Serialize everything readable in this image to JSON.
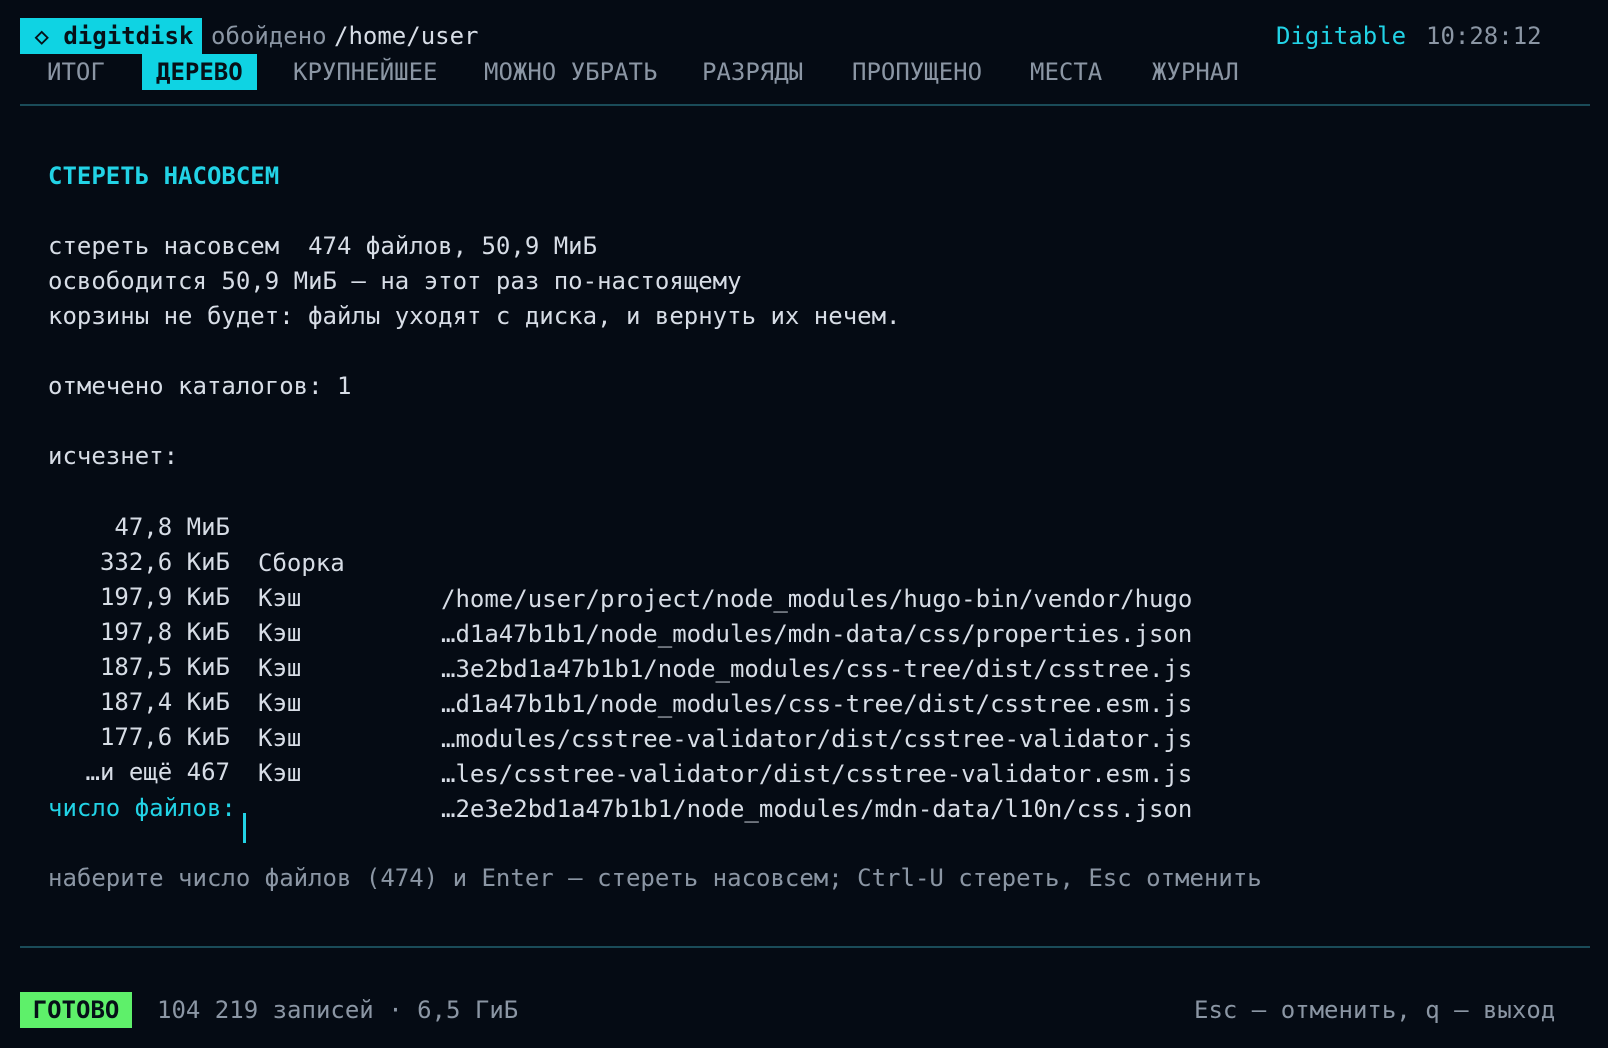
{
  "header": {
    "app_badge": " ◇ digitdisk",
    "scanned_label": "обойдено",
    "path": "/home/user",
    "theme": "Digitable",
    "clock": "10:28:12"
  },
  "tabs": [
    {
      "label": "ИТОГ",
      "active": false
    },
    {
      "label": "ДЕРЕВО",
      "active": true
    },
    {
      "label": "КРУПНЕЙШЕЕ",
      "active": false
    },
    {
      "label": "МОЖНО УБРАТЬ",
      "active": false
    },
    {
      "label": "РАЗРЯДЫ",
      "active": false
    },
    {
      "label": "ПРОПУЩЕНО",
      "active": false
    },
    {
      "label": "МЕСТА",
      "active": false
    },
    {
      "label": "ЖУРНАЛ",
      "active": false
    }
  ],
  "dialog": {
    "title": "СТЕРЕТЬ НАСОВСЕМ",
    "summary_line": "стереть насовсем  474 файлов, 50,9 МиБ",
    "free_line": "освободится 50,9 МиБ — на этот раз по-настоящему",
    "warning_line": "корзины не будет: файлы уходят с диска, и вернуть их нечем.",
    "dirs_line": "отмечено каталогов: 1",
    "vanish_label": "исчезнет:",
    "files": [
      {
        "size": "47,8 МиБ",
        "kind": "Сборка",
        "path": "/home/user/project/node_modules/hugo-bin/vendor/hugo"
      },
      {
        "size": "332,6 КиБ",
        "kind": "Кэш",
        "path": "…d1a47b1b1/node_modules/mdn-data/css/properties.json"
      },
      {
        "size": "197,9 КиБ",
        "kind": "Кэш",
        "path": "…3e2bd1a47b1b1/node_modules/css-tree/dist/csstree.js"
      },
      {
        "size": "197,8 КиБ",
        "kind": "Кэш",
        "path": "…d1a47b1b1/node_modules/css-tree/dist/csstree.esm.js"
      },
      {
        "size": "187,5 КиБ",
        "kind": "Кэш",
        "path": "…modules/csstree-validator/dist/csstree-validator.js"
      },
      {
        "size": "187,4 КиБ",
        "kind": "Кэш",
        "path": "…les/csstree-validator/dist/csstree-validator.esm.js"
      },
      {
        "size": "177,6 КиБ",
        "kind": "Кэш",
        "path": "…2e3e2bd1a47b1b1/node_modules/mdn-data/l10n/css.json"
      }
    ],
    "more_line": "…и ещё 467",
    "input_label": "число файлов:",
    "input_value": "",
    "hint": "наберите число файлов (474) и Enter — стереть насовсем; Ctrl-U стереть, Esc отменить"
  },
  "status": {
    "badge": "ГОТОВО",
    "summary": "104 219 записей · 6,5 ГиБ",
    "keys": "Esc — отменить, q — выход"
  },
  "colors": {
    "background": "#050b14",
    "accent": "#0fd3e3",
    "ready": "#5ef06a",
    "dim": "#8b96a4",
    "text": "#d7dde6"
  }
}
